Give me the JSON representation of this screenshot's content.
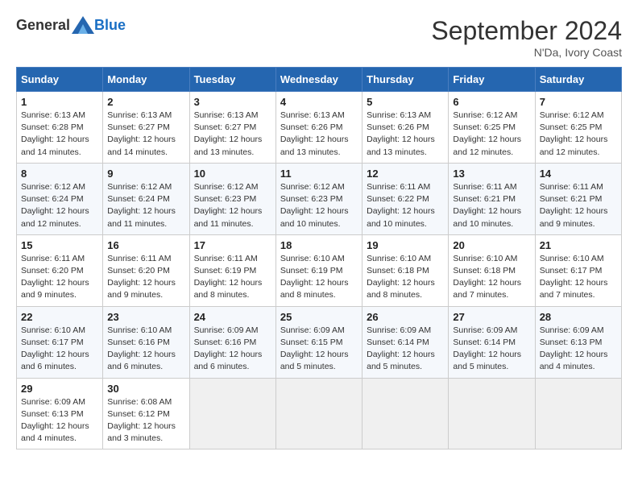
{
  "header": {
    "logo_general": "General",
    "logo_blue": "Blue",
    "month_title": "September 2024",
    "location": "N'Da, Ivory Coast"
  },
  "days_of_week": [
    "Sunday",
    "Monday",
    "Tuesday",
    "Wednesday",
    "Thursday",
    "Friday",
    "Saturday"
  ],
  "weeks": [
    [
      {
        "day": 1,
        "sunrise": "6:13 AM",
        "sunset": "6:28 PM",
        "daylight": "12 hours and 14 minutes."
      },
      {
        "day": 2,
        "sunrise": "6:13 AM",
        "sunset": "6:27 PM",
        "daylight": "12 hours and 14 minutes."
      },
      {
        "day": 3,
        "sunrise": "6:13 AM",
        "sunset": "6:27 PM",
        "daylight": "12 hours and 13 minutes."
      },
      {
        "day": 4,
        "sunrise": "6:13 AM",
        "sunset": "6:26 PM",
        "daylight": "12 hours and 13 minutes."
      },
      {
        "day": 5,
        "sunrise": "6:13 AM",
        "sunset": "6:26 PM",
        "daylight": "12 hours and 13 minutes."
      },
      {
        "day": 6,
        "sunrise": "6:12 AM",
        "sunset": "6:25 PM",
        "daylight": "12 hours and 12 minutes."
      },
      {
        "day": 7,
        "sunrise": "6:12 AM",
        "sunset": "6:25 PM",
        "daylight": "12 hours and 12 minutes."
      }
    ],
    [
      {
        "day": 8,
        "sunrise": "6:12 AM",
        "sunset": "6:24 PM",
        "daylight": "12 hours and 12 minutes."
      },
      {
        "day": 9,
        "sunrise": "6:12 AM",
        "sunset": "6:24 PM",
        "daylight": "12 hours and 11 minutes."
      },
      {
        "day": 10,
        "sunrise": "6:12 AM",
        "sunset": "6:23 PM",
        "daylight": "12 hours and 11 minutes."
      },
      {
        "day": 11,
        "sunrise": "6:12 AM",
        "sunset": "6:23 PM",
        "daylight": "12 hours and 10 minutes."
      },
      {
        "day": 12,
        "sunrise": "6:11 AM",
        "sunset": "6:22 PM",
        "daylight": "12 hours and 10 minutes."
      },
      {
        "day": 13,
        "sunrise": "6:11 AM",
        "sunset": "6:21 PM",
        "daylight": "12 hours and 10 minutes."
      },
      {
        "day": 14,
        "sunrise": "6:11 AM",
        "sunset": "6:21 PM",
        "daylight": "12 hours and 9 minutes."
      }
    ],
    [
      {
        "day": 15,
        "sunrise": "6:11 AM",
        "sunset": "6:20 PM",
        "daylight": "12 hours and 9 minutes."
      },
      {
        "day": 16,
        "sunrise": "6:11 AM",
        "sunset": "6:20 PM",
        "daylight": "12 hours and 9 minutes."
      },
      {
        "day": 17,
        "sunrise": "6:11 AM",
        "sunset": "6:19 PM",
        "daylight": "12 hours and 8 minutes."
      },
      {
        "day": 18,
        "sunrise": "6:10 AM",
        "sunset": "6:19 PM",
        "daylight": "12 hours and 8 minutes."
      },
      {
        "day": 19,
        "sunrise": "6:10 AM",
        "sunset": "6:18 PM",
        "daylight": "12 hours and 8 minutes."
      },
      {
        "day": 20,
        "sunrise": "6:10 AM",
        "sunset": "6:18 PM",
        "daylight": "12 hours and 7 minutes."
      },
      {
        "day": 21,
        "sunrise": "6:10 AM",
        "sunset": "6:17 PM",
        "daylight": "12 hours and 7 minutes."
      }
    ],
    [
      {
        "day": 22,
        "sunrise": "6:10 AM",
        "sunset": "6:17 PM",
        "daylight": "12 hours and 6 minutes."
      },
      {
        "day": 23,
        "sunrise": "6:10 AM",
        "sunset": "6:16 PM",
        "daylight": "12 hours and 6 minutes."
      },
      {
        "day": 24,
        "sunrise": "6:09 AM",
        "sunset": "6:16 PM",
        "daylight": "12 hours and 6 minutes."
      },
      {
        "day": 25,
        "sunrise": "6:09 AM",
        "sunset": "6:15 PM",
        "daylight": "12 hours and 5 minutes."
      },
      {
        "day": 26,
        "sunrise": "6:09 AM",
        "sunset": "6:14 PM",
        "daylight": "12 hours and 5 minutes."
      },
      {
        "day": 27,
        "sunrise": "6:09 AM",
        "sunset": "6:14 PM",
        "daylight": "12 hours and 5 minutes."
      },
      {
        "day": 28,
        "sunrise": "6:09 AM",
        "sunset": "6:13 PM",
        "daylight": "12 hours and 4 minutes."
      }
    ],
    [
      {
        "day": 29,
        "sunrise": "6:09 AM",
        "sunset": "6:13 PM",
        "daylight": "12 hours and 4 minutes."
      },
      {
        "day": 30,
        "sunrise": "6:08 AM",
        "sunset": "6:12 PM",
        "daylight": "12 hours and 3 minutes."
      },
      null,
      null,
      null,
      null,
      null
    ]
  ]
}
